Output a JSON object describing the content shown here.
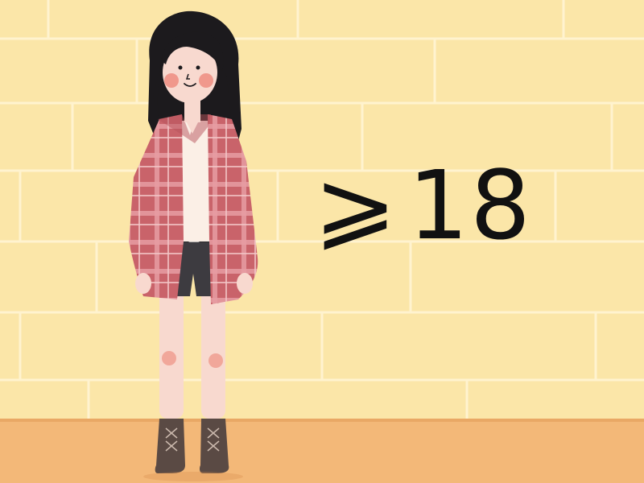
{
  "label": {
    "symbol": "⩾",
    "number": "18"
  },
  "colors": {
    "wall": "#fbe6a8",
    "mortar": "#fff4d2",
    "floor": "#f3b878",
    "coat": "#c9636a",
    "coat_plaid": "#f0b9bb",
    "hair": "#1c1a1d",
    "skin": "#f8d9cf",
    "blush": "#ef8c80",
    "boots": "#5a4a44",
    "text": "#111111"
  },
  "icons": {
    "figure": "standing-girl-illustration"
  }
}
